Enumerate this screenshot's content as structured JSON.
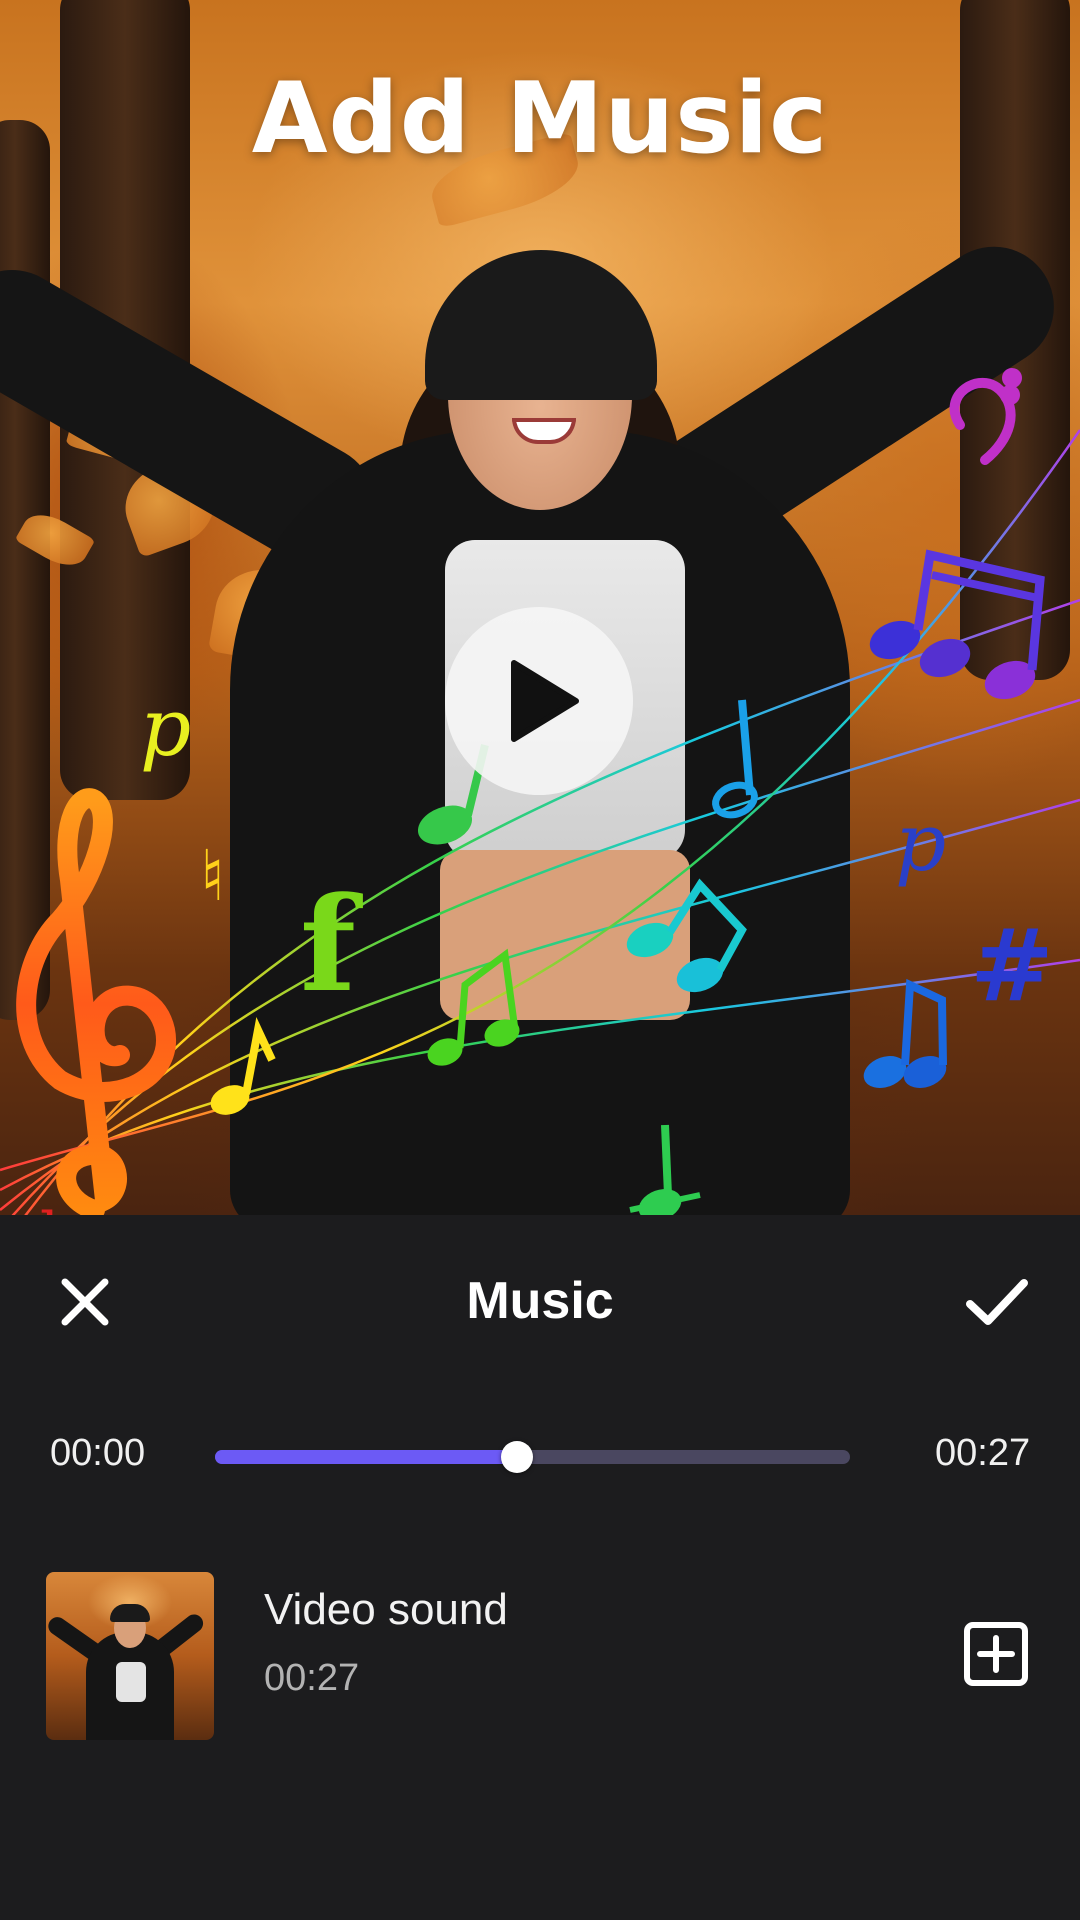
{
  "promo": {
    "headline": "Add Music"
  },
  "preview": {
    "play_icon": "play-icon"
  },
  "panel": {
    "title": "Music",
    "close_icon": "close-icon",
    "confirm_icon": "checkmark-icon"
  },
  "playback": {
    "current_time": "00:00",
    "total_time": "00:27",
    "progress": 0.475
  },
  "sound_list": [
    {
      "name": "Video sound",
      "duration": "00:27",
      "action_icon": "add-square-icon"
    }
  ],
  "colors": {
    "panel_background": "#1c1c1e",
    "accent": "#6c5af5",
    "track": "#4a4760",
    "text_primary": "#ffffff",
    "text_secondary": "#b3b3b3"
  }
}
